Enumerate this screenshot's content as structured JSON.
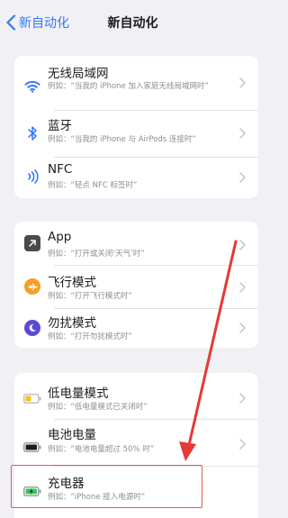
{
  "nav": {
    "back_label": "新自动化",
    "title": "新自动化"
  },
  "groups": [
    {
      "rows": [
        {
          "title": "无线局域网",
          "subtitle": "例如：“当我的 iPhone 加入家庭无线局域网时”",
          "icon": "wifi-icon"
        },
        {
          "title": "蓝牙",
          "subtitle": "例如：“当我的 iPhone 与 AirPods 连接时”",
          "icon": "bluetooth-icon"
        },
        {
          "title": "NFC",
          "subtitle": "例如：“轻点 NFC 标签时”",
          "icon": "nfc-icon"
        }
      ]
    },
    {
      "rows": [
        {
          "title": "App",
          "subtitle": "例如：“打开或关闭‘天气’时”",
          "icon": "app-icon"
        },
        {
          "title": "飞行模式",
          "subtitle": "例如：“打开飞行模式时”",
          "icon": "airplane-icon"
        },
        {
          "title": "勿扰模式",
          "subtitle": "例如：“打开勿扰模式时”",
          "icon": "moon-icon"
        }
      ]
    },
    {
      "rows": [
        {
          "title": "低电量模式",
          "subtitle": "例如：“低电量模式已关闭时”",
          "icon": "low-battery-icon"
        },
        {
          "title": "电池电量",
          "subtitle": "例如：“电池电量超过 50% 时”",
          "icon": "battery-icon"
        },
        {
          "title": "充电器",
          "subtitle": "例如：“iPhone 接入电源时”",
          "icon": "charging-battery-icon"
        }
      ]
    }
  ],
  "colors": {
    "accent": "#3478f6",
    "annotation": "#e53935"
  }
}
